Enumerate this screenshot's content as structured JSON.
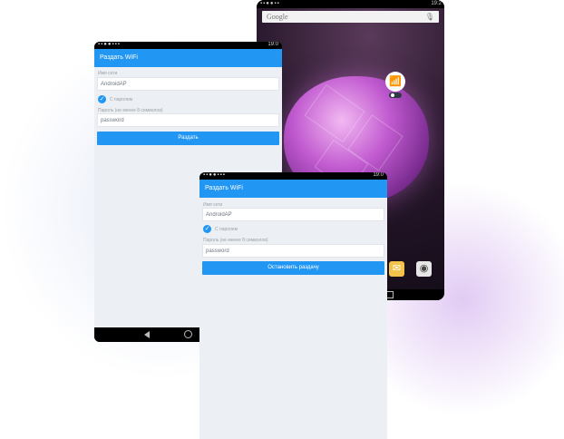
{
  "home_screen": {
    "status_time": "19:2",
    "search_placeholder": "Google",
    "icons": [
      "mic-icon",
      "wifi-hotspot-widget-icon",
      "email-app-icon",
      "camera-app-icon"
    ]
  },
  "app_a": {
    "status_time": "19:0",
    "title": "Раздать WiFi",
    "ssid_label": "Имя сети",
    "ssid_value": "AndroidAP",
    "password_check_label": "С паролем",
    "password_label": "Пароль (не менее 8 символов)",
    "password_value": "password",
    "action_button": "Раздать"
  },
  "app_b": {
    "status_time": "19:0",
    "title": "Раздать WiFi",
    "ssid_label": "Имя сети",
    "ssid_value": "AndroidAP",
    "password_check_label": "С паролем",
    "password_label": "Пароль (не менее 8 символов)",
    "password_value": "password",
    "action_button": "Остановить раздачу"
  },
  "colors": {
    "primary": "#2196f3",
    "background": "#eceff3",
    "wallpaper": "#c15ad0"
  }
}
